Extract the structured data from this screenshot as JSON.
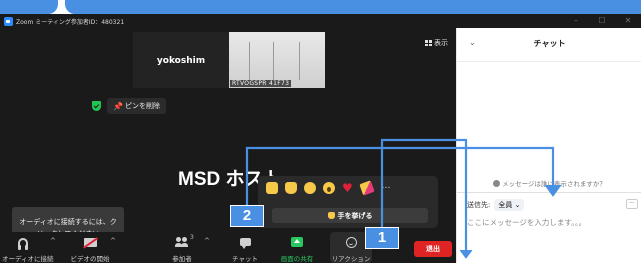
{
  "titlebar": {
    "title": "Zoom ミーティング参加者ID：480321",
    "min": "–",
    "max": "☐",
    "close": "✕"
  },
  "meeting": {
    "view_label": "表示",
    "participant_1": "yokoshim",
    "participant_2_tag": "RTVOGSPR 41F73",
    "unpin_label": "ピンを削除",
    "active_speaker": "MSD ホスト",
    "audio_tooltip_line1": "オーディオに接続するには、ク",
    "audio_tooltip_line2": "リックしてください"
  },
  "reactions": {
    "icons": [
      "clap",
      "thumbs-up",
      "joy",
      "wow",
      "heart",
      "party"
    ],
    "more": "…",
    "raise_hand": "手を挙げる"
  },
  "toolbar": {
    "audio": "オーディオに接続",
    "video": "ビデオの開始",
    "participants": "参加者",
    "participants_count": "3",
    "chat": "チャット",
    "share": "画面の共有",
    "reactions": "リアクション",
    "end": "退出",
    "caret": "^"
  },
  "chat": {
    "title": "チャット",
    "collapse": "⌄",
    "hint": "メッセージは誰に表示されますか？",
    "to_label": "送信先:",
    "to_value": "全員 ⌄",
    "more": "···",
    "placeholder": "ここにメッセージを入力します。。。"
  },
  "callouts": [
    "1",
    "2"
  ],
  "colors": {
    "callout": "#4a90e2",
    "share_green": "#29c75f",
    "end_red": "#e02424",
    "meeting_bg": "#1a1a1a"
  }
}
